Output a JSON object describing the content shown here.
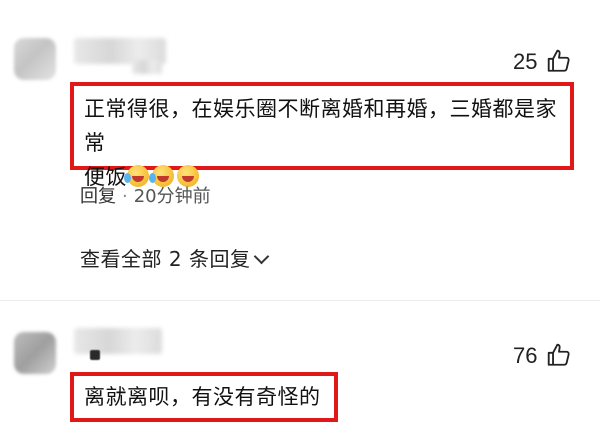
{
  "comments": [
    {
      "likes": "25",
      "text_line1": "正常得很，在娱乐圈不断离婚和再婚，三婚都是家常",
      "text_line2": "便饭",
      "emojis": [
        "laugh-cry-emoji",
        "laugh-cry-emoji",
        "grin-emoji"
      ],
      "reply_label": "回复",
      "time": "20分钟前",
      "view_replies": "查看全部 2 条回复"
    },
    {
      "likes": "76",
      "text_line1": "离就离呗，有没有奇怪的"
    }
  ],
  "colors": {
    "highlight": "#e01818"
  },
  "icons": {
    "like": "thumbs-up-icon",
    "expand": "chevron-down-icon"
  }
}
